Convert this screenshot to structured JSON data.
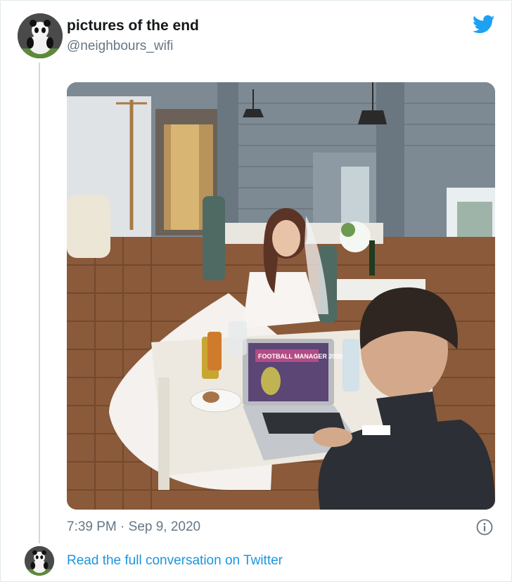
{
  "tweet": {
    "display_name": "pictures of the end",
    "handle": "@neighbours_wifi",
    "timestamp": "7:39 PM · Sep 9, 2020",
    "photo_screen_text": "FOOTBALL MANAGER 2020"
  },
  "footer": {
    "read_link": "Read the full conversation on Twitter"
  },
  "icons": {
    "brand": "twitter-bird-icon",
    "info": "info-icon"
  },
  "colors": {
    "twitter_blue": "#1da1f2",
    "link_blue": "#1b95e0",
    "muted_text": "#657786",
    "thread_line": "#cfd9de"
  }
}
